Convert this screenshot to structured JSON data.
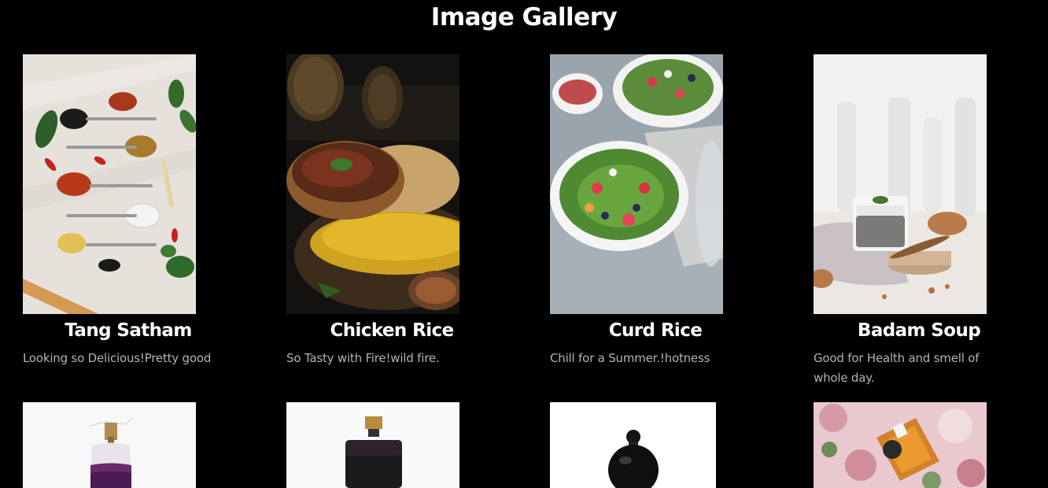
{
  "gallery": {
    "title": "Image Gallery",
    "items": [
      {
        "name": "Tang Satham",
        "description": "Looking so Delicious!Pretty good"
      },
      {
        "name": "Chicken Rice",
        "description": "So Tasty with Fire!wild fire."
      },
      {
        "name": "Curd Rice",
        "description": "Chill for a Summer.!hotness"
      },
      {
        "name": "Badam Soup",
        "description": "Good for Health and smell of whole day."
      }
    ]
  },
  "icons": [
    "spices-photo",
    "curry-rice-photo",
    "salad-photo",
    "chia-pudding-photo",
    "perfume-purple-photo",
    "perfume-black-photo",
    "perfume-round-photo",
    "perfume-floral-photo"
  ]
}
